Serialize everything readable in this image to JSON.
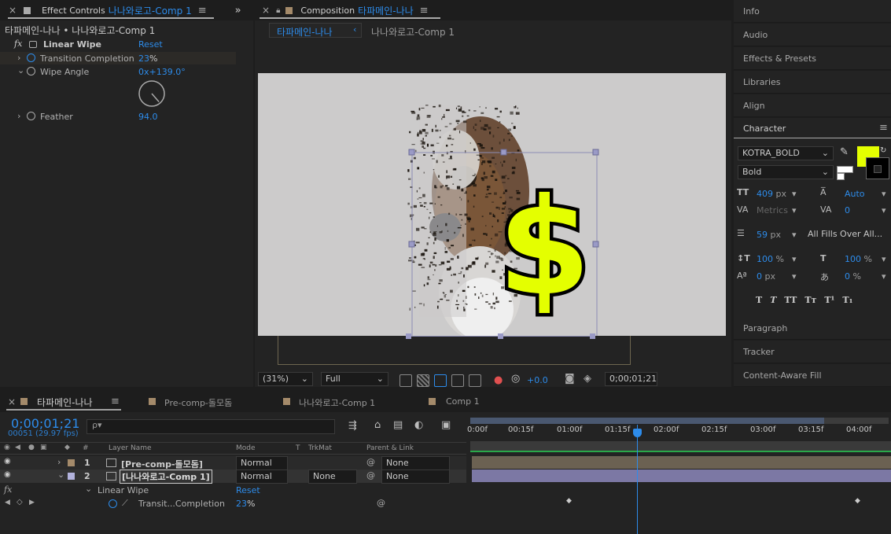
{
  "effect_controls": {
    "close": "×",
    "title": "Effect Controls",
    "comp_name": "나나와로고-Comp 1",
    "menu_glyph": "≡",
    "breadcrumb": "타파메인-나나 • 나나와로고-Comp 1",
    "fx": "fx",
    "effect_name": "Linear Wipe",
    "reset": "Reset",
    "props": [
      {
        "name": "Transition Completion",
        "value": "23",
        "unit": "%"
      },
      {
        "name": "Wipe Angle",
        "value": "0x+139.0°"
      },
      {
        "name": "Feather",
        "value": "94.0"
      }
    ],
    "wipe_angle_deg": 139
  },
  "composition": {
    "close": "×",
    "title": "Composition",
    "comp_name": "타파메인-나나",
    "menu_glyph": "≡",
    "crumb_active": "타파메인-나나",
    "crumb_sep": "‹",
    "crumb_inactive": "나나와로고-Comp 1",
    "zoom": "(31%)",
    "resolution": "Full",
    "exposure": "+0.0",
    "timecode": "0;00;01;21"
  },
  "right_panels": {
    "top": [
      "Info",
      "Audio",
      "Effects & Presets",
      "Libraries",
      "Align"
    ],
    "character_title": "Character",
    "menu_glyph": "≡",
    "font": "KOTRA_BOLD",
    "style": "Bold",
    "fill_color": "#e4ff00",
    "stroke_color": "#000000",
    "size": "409",
    "size_unit": "px",
    "leading": "Auto",
    "kerning": "Metrics",
    "tracking": "0",
    "stroke_width": "59",
    "stroke_unit": "px",
    "stroke_mode": "All Fills Over All...",
    "vscale": "100",
    "hscale": "100",
    "baseline": "0",
    "baseline_unit": "px",
    "tsume": "0",
    "pct": "%",
    "style_buttons": [
      "T",
      "T",
      "TT",
      "Tт",
      "T¹",
      "T₁"
    ],
    "bottom": [
      "Paragraph",
      "Tracker",
      "Content-Aware Fill"
    ]
  },
  "timeline": {
    "close": "×",
    "menu_glyph": "≡",
    "tabs": [
      "타파메인-나나",
      "Pre-comp-돌모돔",
      "나나와로고-Comp 1",
      "Comp 1"
    ],
    "tab_colors": [
      "#a48a6a",
      "#a48a6a",
      "#a48a6a",
      "#a48a6a"
    ],
    "timecode": "0;00;01;21",
    "frames": "00051 (29.97 fps)",
    "search_placeholder": "ρ▾",
    "cols": {
      "num": "#",
      "layer": "Layer Name",
      "mode": "Mode",
      "t": "T",
      "trkmat": "TrkMat",
      "parent": "Parent & Link"
    },
    "layers": [
      {
        "num": "1",
        "name": "[Pre-comp-돌모돔]",
        "mode": "Normal",
        "trkmat": "",
        "parent": "None",
        "color": "#a48a6a"
      },
      {
        "num": "2",
        "name": "[나나와로고-Comp 1]",
        "mode": "Normal",
        "trkmat": "None",
        "parent": "None",
        "color": "#b2b2dc"
      }
    ],
    "effect": "Linear Wipe",
    "reset": "Reset",
    "prop": "Transit...Completion",
    "prop_value": "23",
    "prop_unit": "%",
    "ruler": [
      "0:00f",
      "00:15f",
      "01:00f",
      "01:15f",
      "02:00f",
      "02:15f",
      "03:00f",
      "03:15f",
      "04:00f"
    ]
  }
}
